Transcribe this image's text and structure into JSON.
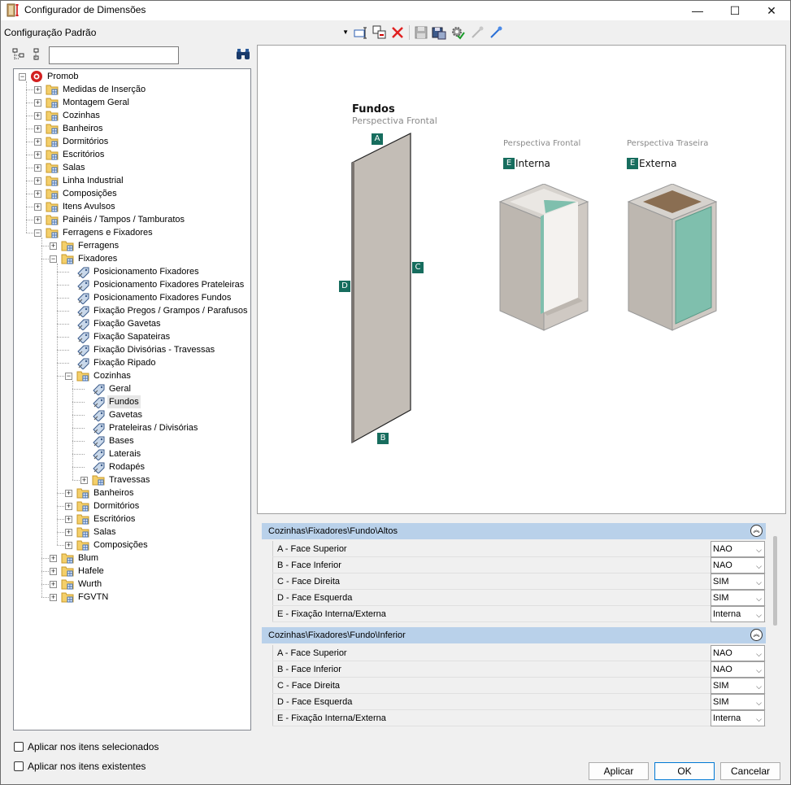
{
  "window": {
    "title": "Configurador de Dimensões",
    "minimize": "—",
    "maximize": "☐",
    "close": "✕"
  },
  "config": {
    "selected": "Configuração Padrão"
  },
  "tree": {
    "items": [
      {
        "label": "Promob",
        "level": 0,
        "exp": "-",
        "icon": "promob"
      },
      {
        "label": "Medidas de Inserção",
        "level": 1,
        "exp": "+",
        "icon": "folder"
      },
      {
        "label": "Montagem Geral",
        "level": 1,
        "exp": "+",
        "icon": "folder"
      },
      {
        "label": "Cozinhas",
        "level": 1,
        "exp": "+",
        "icon": "folder"
      },
      {
        "label": "Banheiros",
        "level": 1,
        "exp": "+",
        "icon": "folder"
      },
      {
        "label": "Dormitórios",
        "level": 1,
        "exp": "+",
        "icon": "folder"
      },
      {
        "label": "Escritórios",
        "level": 1,
        "exp": "+",
        "icon": "folder"
      },
      {
        "label": "Salas",
        "level": 1,
        "exp": "+",
        "icon": "folder"
      },
      {
        "label": "Linha Industrial",
        "level": 1,
        "exp": "+",
        "icon": "folder"
      },
      {
        "label": "Composições",
        "level": 1,
        "exp": "+",
        "icon": "folder"
      },
      {
        "label": "Itens Avulsos",
        "level": 1,
        "exp": "+",
        "icon": "folder"
      },
      {
        "label": "Painéis / Tampos / Tamburatos",
        "level": 1,
        "exp": "+",
        "icon": "folder"
      },
      {
        "label": "Ferragens e Fixadores",
        "level": 1,
        "exp": "-",
        "icon": "folder"
      },
      {
        "label": "Ferragens",
        "level": 2,
        "exp": "+",
        "icon": "folder"
      },
      {
        "label": "Fixadores",
        "level": 2,
        "exp": "-",
        "icon": "folder"
      },
      {
        "label": "Posicionamento Fixadores",
        "level": 3,
        "exp": "",
        "icon": "tag"
      },
      {
        "label": "Posicionamento Fixadores Prateleiras",
        "level": 3,
        "exp": "",
        "icon": "tag"
      },
      {
        "label": "Posicionamento Fixadores Fundos",
        "level": 3,
        "exp": "",
        "icon": "tag"
      },
      {
        "label": "Fixação Pregos / Grampos / Parafusos",
        "level": 3,
        "exp": "",
        "icon": "tag"
      },
      {
        "label": "Fixação Gavetas",
        "level": 3,
        "exp": "",
        "icon": "tag"
      },
      {
        "label": "Fixação Sapateiras",
        "level": 3,
        "exp": "",
        "icon": "tag"
      },
      {
        "label": "Fixação Divisórias - Travessas",
        "level": 3,
        "exp": "",
        "icon": "tag"
      },
      {
        "label": "Fixação Ripado",
        "level": 3,
        "exp": "",
        "icon": "tag"
      },
      {
        "label": "Cozinhas",
        "level": 3,
        "exp": "-",
        "icon": "folder"
      },
      {
        "label": "Geral",
        "level": 4,
        "exp": "",
        "icon": "tag"
      },
      {
        "label": "Fundos",
        "level": 4,
        "exp": "",
        "icon": "tag",
        "selected": true
      },
      {
        "label": "Gavetas",
        "level": 4,
        "exp": "",
        "icon": "tag"
      },
      {
        "label": "Prateleiras / Divisórias",
        "level": 4,
        "exp": "",
        "icon": "tag"
      },
      {
        "label": "Bases",
        "level": 4,
        "exp": "",
        "icon": "tag"
      },
      {
        "label": "Laterais",
        "level": 4,
        "exp": "",
        "icon": "tag"
      },
      {
        "label": "Rodapés",
        "level": 4,
        "exp": "",
        "icon": "tag"
      },
      {
        "label": "Travessas",
        "level": 4,
        "exp": "+",
        "icon": "folder"
      },
      {
        "label": "Banheiros",
        "level": 3,
        "exp": "+",
        "icon": "folder"
      },
      {
        "label": "Dormitórios",
        "level": 3,
        "exp": "+",
        "icon": "folder"
      },
      {
        "label": "Escritórios",
        "level": 3,
        "exp": "+",
        "icon": "folder"
      },
      {
        "label": "Salas",
        "level": 3,
        "exp": "+",
        "icon": "folder"
      },
      {
        "label": "Composições",
        "level": 3,
        "exp": "+",
        "icon": "folder"
      },
      {
        "label": "Blum",
        "level": 2,
        "exp": "+",
        "icon": "folder"
      },
      {
        "label": "Hafele",
        "level": 2,
        "exp": "+",
        "icon": "folder"
      },
      {
        "label": "Wurth",
        "level": 2,
        "exp": "+",
        "icon": "folder"
      },
      {
        "label": "FGVTN",
        "level": 2,
        "exp": "+",
        "icon": "folder"
      }
    ]
  },
  "preview": {
    "title": "Fundos",
    "subtitle": "Perspectiva Frontal",
    "badges": {
      "a": "A",
      "b": "B",
      "c": "C",
      "d": "D"
    },
    "left_view": {
      "caption": "Perspectiva Frontal",
      "badge": "E",
      "label": "Interna"
    },
    "right_view": {
      "caption": "Perspectiva Traseira",
      "badge": "E",
      "label": "Externa"
    }
  },
  "colors": {
    "accent": "#176d5e",
    "header": "#b9d1ea",
    "glass": "#7fbfad"
  },
  "groups": [
    {
      "title": "Cozinhas\\Fixadores\\Fundo\\Altos",
      "collapse": "︽",
      "rows": [
        {
          "name": "A - Face Superior",
          "value": "NAO"
        },
        {
          "name": "B - Face Inferior",
          "value": "NAO"
        },
        {
          "name": "C - Face Direita",
          "value": "SIM"
        },
        {
          "name": "D - Face Esquerda",
          "value": "SIM"
        },
        {
          "name": "E - Fixação Interna/Externa",
          "value": "Interna"
        }
      ]
    },
    {
      "title": "Cozinhas\\Fixadores\\Fundo\\Inferior",
      "collapse": "︽",
      "rows": [
        {
          "name": "A - Face Superior",
          "value": "NAO"
        },
        {
          "name": "B - Face Inferior",
          "value": "NAO"
        },
        {
          "name": "C - Face Direita",
          "value": "SIM"
        },
        {
          "name": "D - Face Esquerda",
          "value": "SIM"
        },
        {
          "name": "E - Fixação Interna/Externa",
          "value": "Interna"
        }
      ]
    }
  ],
  "bottom": {
    "apply_selected": "Aplicar nos itens selecionados",
    "apply_existing": "Aplicar nos itens existentes",
    "apply": "Aplicar",
    "ok": "OK",
    "cancel": "Cancelar"
  }
}
